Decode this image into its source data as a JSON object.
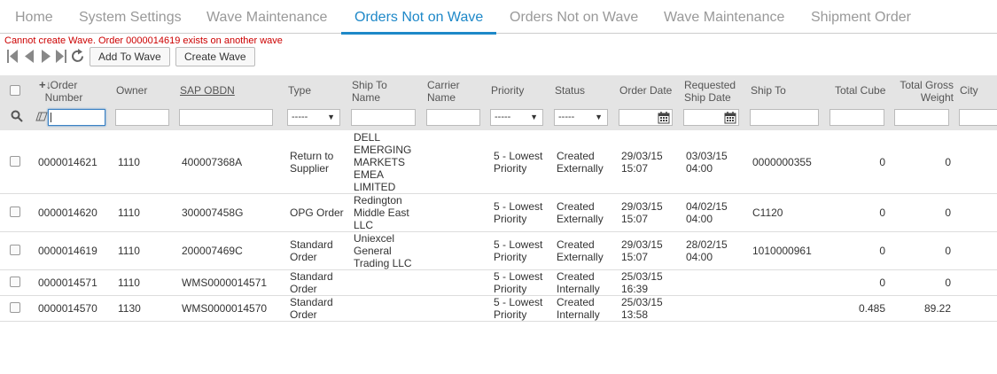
{
  "tabs": [
    {
      "label": "Home"
    },
    {
      "label": "System Settings"
    },
    {
      "label": "Wave Maintenance"
    },
    {
      "label": "Orders Not on Wave"
    },
    {
      "label": "Orders Not on Wave"
    },
    {
      "label": "Wave Maintenance"
    },
    {
      "label": "Shipment Order"
    }
  ],
  "error_message": "Cannot create Wave. Order 0000014619 exists on another wave",
  "toolbar": {
    "add_to_wave": "Add To Wave",
    "create_wave": "Create Wave"
  },
  "columns": {
    "order_number": "Order Number",
    "owner": "Owner",
    "sap_obdn": "SAP OBDN",
    "type": "Type",
    "ship_to_name": "Ship To Name",
    "carrier_name": "Carrier Name",
    "priority": "Priority",
    "status": "Status",
    "order_date": "Order Date",
    "requested_ship_date": "Requested Ship Date",
    "ship_to": "Ship To",
    "total_cube": "Total Cube",
    "total_gross_weight": "Total Gross Weight",
    "city": "City"
  },
  "filters": {
    "type_value": "-----",
    "priority_value": "-----",
    "status_value": "-----"
  },
  "rows": [
    {
      "order_number": "0000014621",
      "owner": "1110",
      "sap_obdn": "400007368A",
      "type": [
        "Return to",
        "Supplier"
      ],
      "ship_to_name": [
        "DELL",
        "EMERGING",
        "MARKETS",
        "EMEA",
        "LIMITED"
      ],
      "carrier_name": "",
      "priority": [
        "5 - Lowest",
        "Priority"
      ],
      "status": [
        "Created",
        "Externally"
      ],
      "order_date": [
        "29/03/15",
        "15:07"
      ],
      "requested_ship_date": [
        "03/03/15",
        "04:00"
      ],
      "ship_to": "0000000355",
      "total_cube": "0",
      "total_gross_weight": "0"
    },
    {
      "order_number": "0000014620",
      "owner": "1110",
      "sap_obdn": "300007458G",
      "type": [
        "OPG Order"
      ],
      "ship_to_name": [
        "Redington",
        "Middle East",
        "LLC"
      ],
      "carrier_name": "",
      "priority": [
        "5 - Lowest",
        "Priority"
      ],
      "status": [
        "Created",
        "Externally"
      ],
      "order_date": [
        "29/03/15",
        "15:07"
      ],
      "requested_ship_date": [
        "04/02/15",
        "04:00"
      ],
      "ship_to": "C1120",
      "total_cube": "0",
      "total_gross_weight": "0"
    },
    {
      "order_number": "0000014619",
      "owner": "1110",
      "sap_obdn": "200007469C",
      "type": [
        "Standard",
        "Order"
      ],
      "ship_to_name": [
        "Uniexcel",
        "General",
        "Trading LLC"
      ],
      "carrier_name": "",
      "priority": [
        "5 - Lowest",
        "Priority"
      ],
      "status": [
        "Created",
        "Externally"
      ],
      "order_date": [
        "29/03/15",
        "15:07"
      ],
      "requested_ship_date": [
        "28/02/15",
        "04:00"
      ],
      "ship_to": "1010000961",
      "total_cube": "0",
      "total_gross_weight": "0"
    },
    {
      "order_number": "0000014571",
      "owner": "1110",
      "sap_obdn": "WMS0000014571",
      "type": [
        "Standard",
        "Order"
      ],
      "ship_to_name": [],
      "carrier_name": "",
      "priority": [
        "5 - Lowest",
        "Priority"
      ],
      "status": [
        "Created",
        "Internally"
      ],
      "order_date": [
        "25/03/15",
        "16:39"
      ],
      "requested_ship_date": [],
      "ship_to": "",
      "total_cube": "0",
      "total_gross_weight": "0"
    },
    {
      "order_number": "0000014570",
      "owner": "1130",
      "sap_obdn": "WMS0000014570",
      "type": [
        "Standard",
        "Order"
      ],
      "ship_to_name": [],
      "carrier_name": "",
      "priority": [
        "5 - Lowest",
        "Priority"
      ],
      "status": [
        "Created",
        "Internally"
      ],
      "order_date": [
        "25/03/15",
        "13:58"
      ],
      "requested_ship_date": [],
      "ship_to": "",
      "total_cube": "0.485",
      "total_gross_weight": "89.22"
    }
  ],
  "colors": {
    "accent": "#1e88c8",
    "error": "#cc0000",
    "header_bg": "#e4e4e4"
  }
}
